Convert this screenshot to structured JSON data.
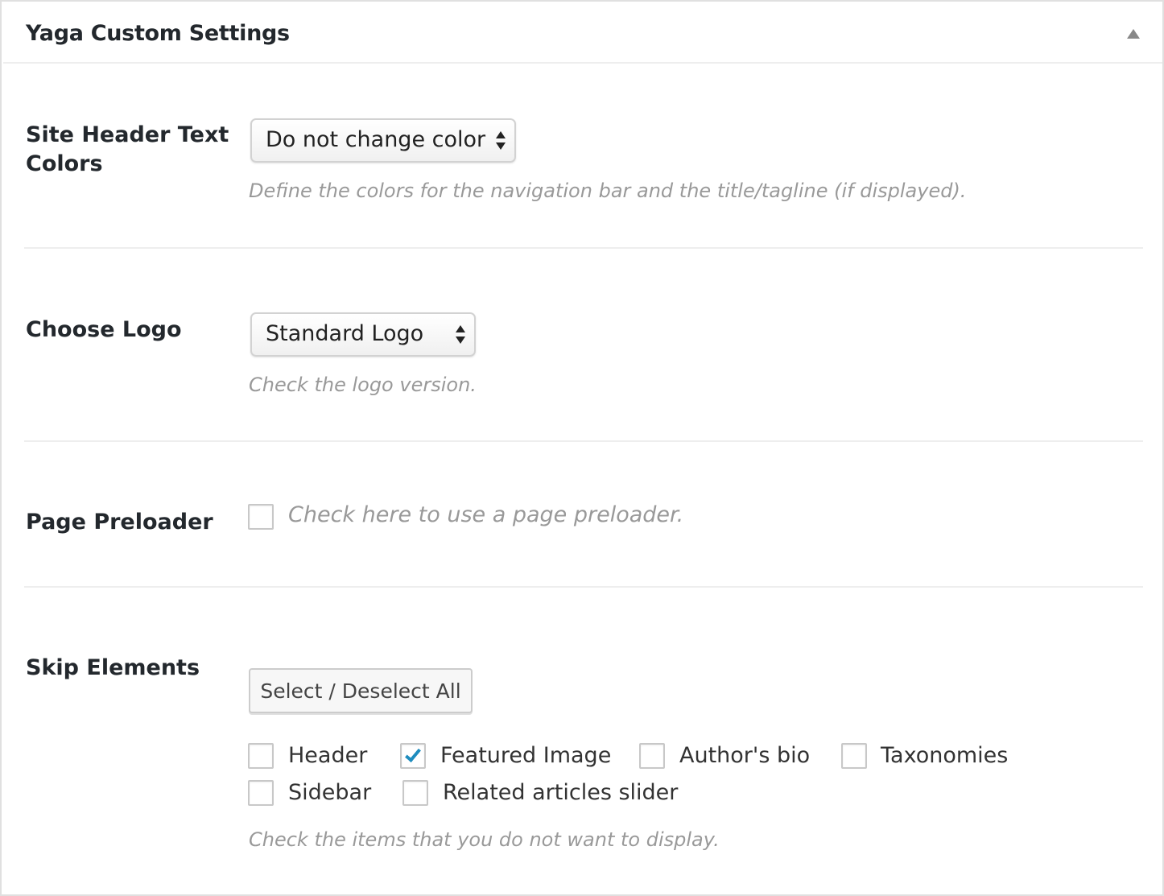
{
  "panel": {
    "title": "Yaga Custom Settings",
    "toggle_icon": "triangle-up-icon"
  },
  "header_colors": {
    "label": "Site Header Text Colors",
    "label_line1": "Site Header Text",
    "label_line2": "Colors",
    "selected": "Do not change color",
    "description": "Define the colors for the navigation bar and the title/tagline (if displayed)."
  },
  "logo": {
    "label": "Choose Logo",
    "selected": "Standard Logo",
    "description": "Check the logo version."
  },
  "preloader": {
    "label": "Page Preloader",
    "checkbox_label": "Check here to use a page preloader.",
    "checked": false
  },
  "skip": {
    "label": "Skip Elements",
    "button_label": "Select / Deselect All",
    "items": [
      {
        "label": "Header",
        "checked": false
      },
      {
        "label": "Featured Image",
        "checked": true
      },
      {
        "label": "Author's bio",
        "checked": false
      },
      {
        "label": "Taxonomies",
        "checked": false
      },
      {
        "label": "Sidebar",
        "checked": false
      },
      {
        "label": "Related articles slider",
        "checked": false
      }
    ],
    "description": "Check the items that you do not want to display."
  },
  "colors": {
    "check_accent": "#1e8cbe",
    "description_text": "#999999",
    "label_text": "#23282d"
  }
}
